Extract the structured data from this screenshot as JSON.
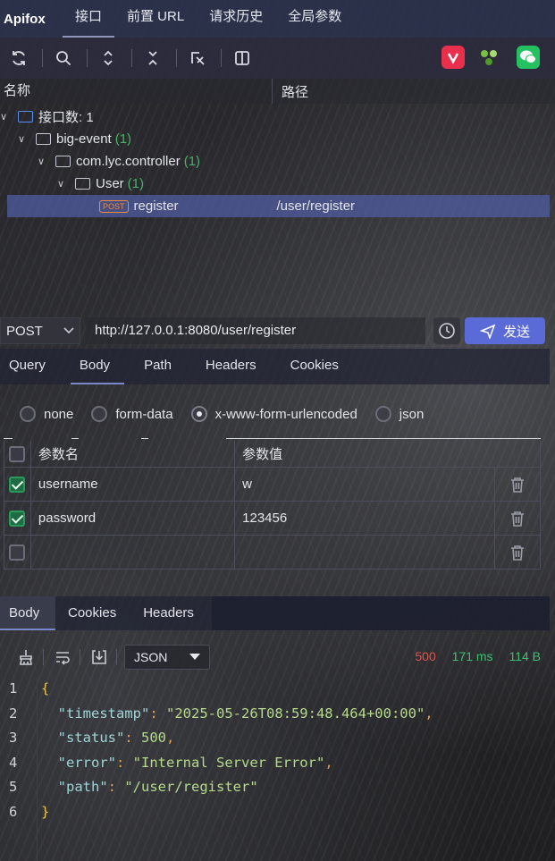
{
  "app": {
    "brand": "Apifox",
    "tabs": [
      "接口",
      "前置 URL",
      "请求历史",
      "全局参数"
    ],
    "active_tab": 0
  },
  "toolbar": {
    "icons": [
      "refresh-icon",
      "search-icon",
      "expand-icon",
      "collapse-icon",
      "locate-icon",
      "split-icon"
    ],
    "extensions": [
      "apifox-logo-icon",
      "plugin-icon",
      "wechat-icon"
    ]
  },
  "tree": {
    "col_name": "名称",
    "col_path": "路径",
    "root": {
      "label": "接口数: 1"
    },
    "project": {
      "label": "big-event",
      "count": "(1)"
    },
    "package": {
      "label": "com.lyc.controller",
      "count": "(1)"
    },
    "class": {
      "label": "User",
      "count": "(1)"
    },
    "endpoint": {
      "method_badge": "POST",
      "label": "register",
      "path": "/user/register"
    }
  },
  "request": {
    "method": "POST",
    "url": "http://127.0.0.1:8080/user/register",
    "send_label": "发送",
    "tabs": [
      "Query",
      "Body",
      "Path",
      "Headers",
      "Cookies"
    ],
    "active_tab": "Body",
    "body_types": [
      "none",
      "form-data",
      "x-www-form-urlencoded",
      "json"
    ],
    "selected_body_type": "x-www-form-urlencoded",
    "params_header": {
      "name": "参数名",
      "value": "参数值"
    },
    "params": [
      {
        "checked": true,
        "name": "username",
        "value": "w"
      },
      {
        "checked": true,
        "name": "password",
        "value": "123456"
      },
      {
        "checked": false,
        "name": "",
        "value": ""
      }
    ]
  },
  "response": {
    "tabs": [
      "Body",
      "Cookies",
      "Headers"
    ],
    "active_tab": "Body",
    "format": "JSON",
    "status": "500",
    "time": "171 ms",
    "size": "114 B",
    "line_numbers": [
      "1",
      "2",
      "3",
      "4",
      "5",
      "6"
    ],
    "json": {
      "open": "{",
      "close": "}",
      "timestamp_key": "\"timestamp\"",
      "timestamp_val": "\"2025-05-26T08:59:48.464+00:00\"",
      "status_key": "\"status\"",
      "status_val": "500",
      "error_key": "\"error\"",
      "error_val": "\"Internal Server Error\"",
      "path_key": "\"path\"",
      "path_val": "\"/user/register\""
    }
  },
  "colors": {
    "accent": "#5a6ad6",
    "status_error": "#e0544e",
    "status_ok": "#3fbf75",
    "post_badge": "#f08b3a"
  }
}
